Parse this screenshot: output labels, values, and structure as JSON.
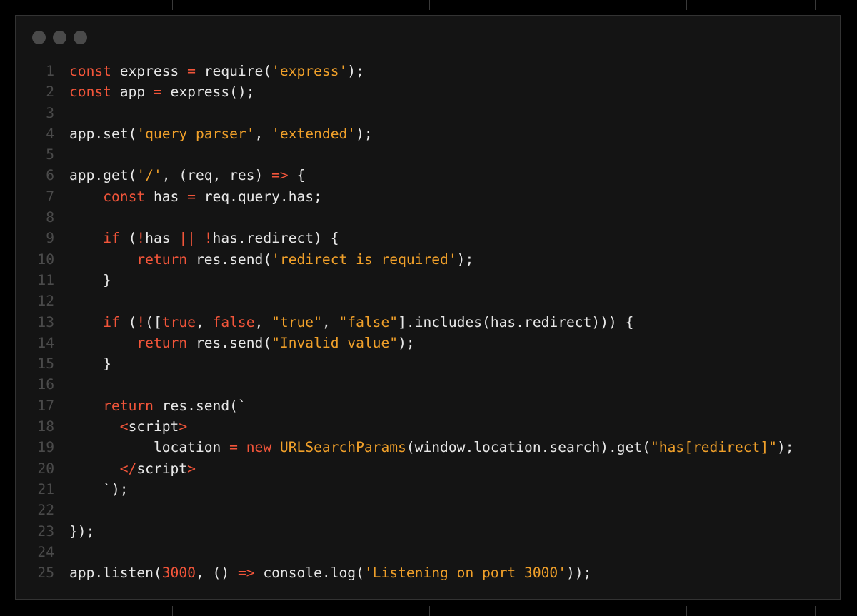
{
  "colors": {
    "page_background": "#000000",
    "window_background": "#141414",
    "window_border": "#333333",
    "control_dot": "#4a4a4a",
    "line_number": "#4a4a4a",
    "text": "#e8e8e8",
    "keyword": "#f2553a",
    "string": "#f0a02a"
  },
  "window_controls": [
    "close-dot",
    "minimize-dot",
    "maximize-dot"
  ],
  "code_lines": [
    {
      "n": "1",
      "tokens": [
        [
          "kw",
          "const"
        ],
        [
          "plain",
          " express "
        ],
        [
          "op",
          "="
        ],
        [
          "plain",
          " require("
        ],
        [
          "str",
          "'express'"
        ],
        [
          "plain",
          ");"
        ]
      ]
    },
    {
      "n": "2",
      "tokens": [
        [
          "kw",
          "const"
        ],
        [
          "plain",
          " app "
        ],
        [
          "op",
          "="
        ],
        [
          "plain",
          " express();"
        ]
      ]
    },
    {
      "n": "3",
      "tokens": []
    },
    {
      "n": "4",
      "tokens": [
        [
          "plain",
          "app.set("
        ],
        [
          "str",
          "'query parser'"
        ],
        [
          "plain",
          ", "
        ],
        [
          "str",
          "'extended'"
        ],
        [
          "plain",
          ");"
        ]
      ]
    },
    {
      "n": "5",
      "tokens": []
    },
    {
      "n": "6",
      "tokens": [
        [
          "plain",
          "app.get("
        ],
        [
          "str",
          "'/'"
        ],
        [
          "plain",
          ", (req, res) "
        ],
        [
          "op",
          "=>"
        ],
        [
          "plain",
          " {"
        ]
      ]
    },
    {
      "n": "7",
      "tokens": [
        [
          "plain",
          "    "
        ],
        [
          "kw",
          "const"
        ],
        [
          "plain",
          " has "
        ],
        [
          "op",
          "="
        ],
        [
          "plain",
          " req.query.has;"
        ]
      ]
    },
    {
      "n": "8",
      "tokens": []
    },
    {
      "n": "9",
      "tokens": [
        [
          "plain",
          "    "
        ],
        [
          "kw",
          "if"
        ],
        [
          "plain",
          " ("
        ],
        [
          "op",
          "!"
        ],
        [
          "plain",
          "has "
        ],
        [
          "op",
          "||"
        ],
        [
          "plain",
          " "
        ],
        [
          "op",
          "!"
        ],
        [
          "plain",
          "has.redirect) {"
        ]
      ]
    },
    {
      "n": "10",
      "tokens": [
        [
          "plain",
          "        "
        ],
        [
          "kw",
          "return"
        ],
        [
          "plain",
          " res.send("
        ],
        [
          "str",
          "'redirect is required'"
        ],
        [
          "plain",
          ");"
        ]
      ]
    },
    {
      "n": "11",
      "tokens": [
        [
          "plain",
          "    }"
        ]
      ]
    },
    {
      "n": "12",
      "tokens": []
    },
    {
      "n": "13",
      "tokens": [
        [
          "plain",
          "    "
        ],
        [
          "kw",
          "if"
        ],
        [
          "plain",
          " ("
        ],
        [
          "op",
          "!"
        ],
        [
          "plain",
          "(["
        ],
        [
          "kw",
          "true"
        ],
        [
          "plain",
          ", "
        ],
        [
          "kw",
          "false"
        ],
        [
          "plain",
          ", "
        ],
        [
          "str",
          "\"true\""
        ],
        [
          "plain",
          ", "
        ],
        [
          "str",
          "\"false\""
        ],
        [
          "plain",
          "].includes(has.redirect))) {"
        ]
      ]
    },
    {
      "n": "14",
      "tokens": [
        [
          "plain",
          "        "
        ],
        [
          "kw",
          "return"
        ],
        [
          "plain",
          " res.send("
        ],
        [
          "str",
          "\"Invalid value\""
        ],
        [
          "plain",
          ");"
        ]
      ]
    },
    {
      "n": "15",
      "tokens": [
        [
          "plain",
          "    }"
        ]
      ]
    },
    {
      "n": "16",
      "tokens": []
    },
    {
      "n": "17",
      "tokens": [
        [
          "plain",
          "    "
        ],
        [
          "kw",
          "return"
        ],
        [
          "plain",
          " res.send(`"
        ]
      ]
    },
    {
      "n": "18",
      "tokens": [
        [
          "plain",
          "      "
        ],
        [
          "op",
          "<"
        ],
        [
          "plain",
          "script"
        ],
        [
          "op",
          ">"
        ]
      ]
    },
    {
      "n": "19",
      "tokens": [
        [
          "plain",
          "          location "
        ],
        [
          "op",
          "="
        ],
        [
          "plain",
          " "
        ],
        [
          "kw",
          "new"
        ],
        [
          "plain",
          " "
        ],
        [
          "str",
          "URLSearchParams"
        ],
        [
          "plain",
          "(window.location.search).get("
        ],
        [
          "str",
          "\"has[redirect]\""
        ],
        [
          "plain",
          ");"
        ]
      ]
    },
    {
      "n": "20",
      "tokens": [
        [
          "plain",
          "      "
        ],
        [
          "op",
          "</"
        ],
        [
          "plain",
          "script"
        ],
        [
          "op",
          ">"
        ]
      ]
    },
    {
      "n": "21",
      "tokens": [
        [
          "plain",
          "    `);"
        ]
      ]
    },
    {
      "n": "22",
      "tokens": []
    },
    {
      "n": "23",
      "tokens": [
        [
          "plain",
          "});"
        ]
      ]
    },
    {
      "n": "24",
      "tokens": []
    },
    {
      "n": "25",
      "tokens": [
        [
          "plain",
          "app.listen("
        ],
        [
          "num",
          "3000"
        ],
        [
          "plain",
          ", () "
        ],
        [
          "op",
          "=>"
        ],
        [
          "plain",
          " console.log("
        ],
        [
          "str",
          "'Listening on port 3000'"
        ],
        [
          "plain",
          "));"
        ]
      ]
    }
  ]
}
